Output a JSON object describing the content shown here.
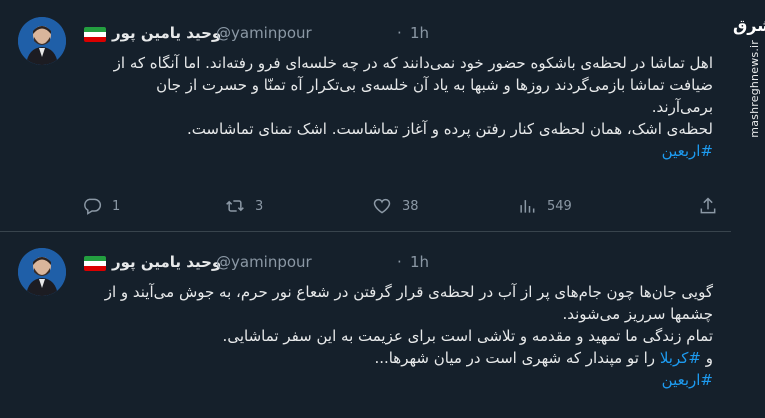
{
  "watermark": {
    "logo": "مشرق",
    "url": "mashreghnews.ir"
  },
  "tweets": [
    {
      "author_name": "وحید یامین پور",
      "handle": "@yaminpour",
      "dot": "·",
      "time": "1h",
      "lines": [
        "اهل تماشا در لحظه‌ی باشکوه حضور خود نمی‌دانند که در چه خلسه‌ای فرو رفته‌اند. اما آنگاه که از ضیافت تماشا بازمی‌گردند روزها و شبها به یاد آن خلسه‌ی بی‌تکرار آه تمنّا و حسرت از جان برمی‌آرند.",
        "لحظه‌ی اشک، همان لحظه‌ی کنار رفتن پرده و آغاز تماشاست. اشک تمنای تماشاست."
      ],
      "hashtag": "#اربعین",
      "stats": {
        "replies": "1",
        "retweets": "3",
        "likes": "38",
        "views": "549"
      }
    },
    {
      "author_name": "وحید یامین پور",
      "handle": "@yaminpour",
      "dot": "·",
      "time": "1h",
      "lines": [
        "گویی جان‌ها چون جام‌های پر از آب در لحظه‌ی قرار گرفتن در شعاع نور حرم، به جوش می‌آیند و از چشمها سرریز می‌شوند.",
        "تمام زندگی ما تمهید و مقدمه و تلاشی است برای عزیمت به این سفر تماشایی."
      ],
      "line3_prefix": "و",
      "line3_hashtag": "#کربلا",
      "line3_suffix": "را تو مپندار که شهری است در میان شهرها...",
      "hashtag": "#اربعین"
    }
  ],
  "colors": {
    "background": "#15202b",
    "accent": "#1d9bf0",
    "muted": "#8b98a5",
    "divider": "#38444d"
  }
}
